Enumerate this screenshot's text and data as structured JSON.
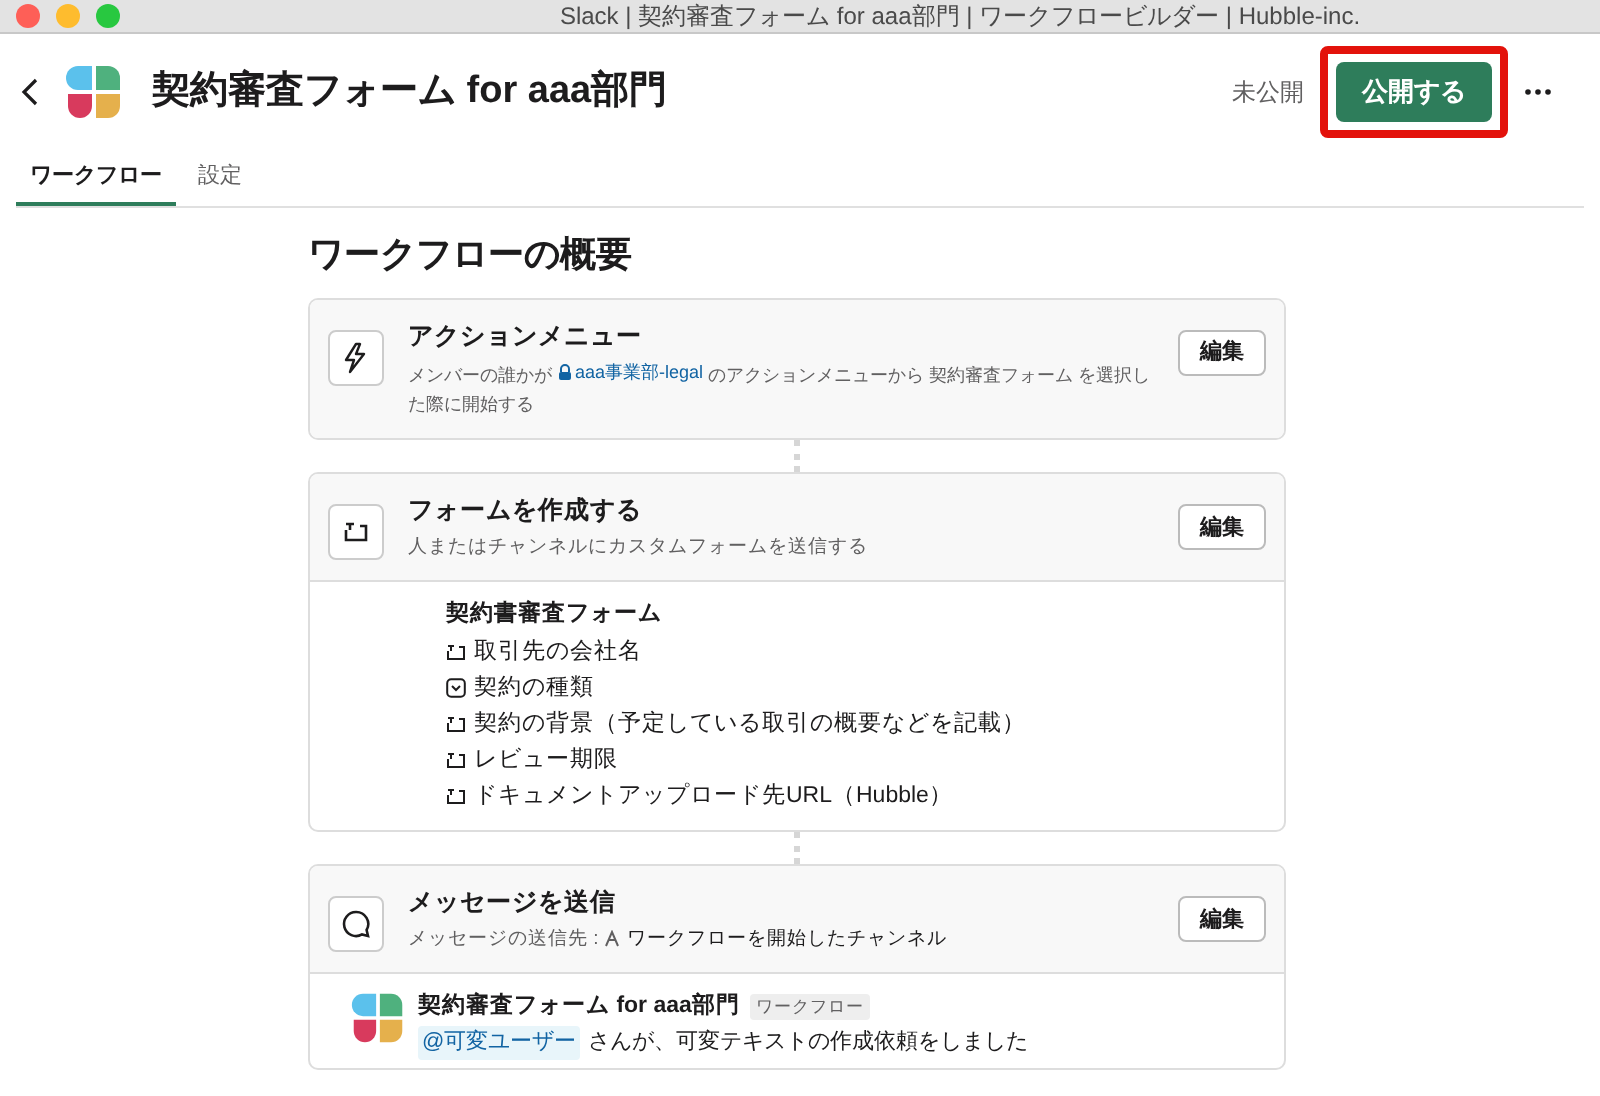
{
  "window": {
    "title": "Slack | 契約審査フォーム for aaa部門 | ワークフロービルダー | Hubble-inc."
  },
  "header": {
    "title": "契約審査フォーム for aaa部門",
    "status": "未公開",
    "publish_button": {
      "label": "公開する",
      "highlighted": true
    }
  },
  "tabs": [
    {
      "label": "ワークフロー",
      "selected": true
    },
    {
      "label": "設定",
      "selected": false
    }
  ],
  "heading": "ワークフローの概要",
  "steps": [
    {
      "kind": "trigger",
      "title": "アクションメニュー",
      "description": {
        "before": "メンバーの誰かが",
        "channel": "aaa事業部-legal",
        "after": "のアクションメニューから 契約審査フォーム を選択した際に開始する"
      },
      "edit": "編集"
    },
    {
      "kind": "form",
      "title": "フォームを作成する",
      "description": {
        "before": "人またはチャンネルにカスタムフォームを送信する"
      },
      "edit": "編集",
      "form": {
        "title": "契約書審査フォーム",
        "fields": [
          {
            "kind": "text",
            "label": "取引先の会社名"
          },
          {
            "kind": "select",
            "label": "契約の種類"
          },
          {
            "kind": "text",
            "label": "契約の背景（予定している取引の概要などを記載）"
          },
          {
            "kind": "text",
            "label": "レビュー期限"
          },
          {
            "kind": "text",
            "label": "ドキュメントアップロード先URL（Hubble）"
          }
        ]
      }
    },
    {
      "kind": "message",
      "title": "メッセージを送信",
      "description": {
        "before": "メッセージの送信先 :",
        "target": "ワークフローを開始したチャンネル"
      },
      "edit": "編集",
      "preview": {
        "sender": "契約審査フォーム for aaa部門",
        "badge": "ワークフロー",
        "mention": "@可変ユーザー",
        "text": "さんが、可変テキストの作成依頼をしました"
      }
    }
  ]
}
